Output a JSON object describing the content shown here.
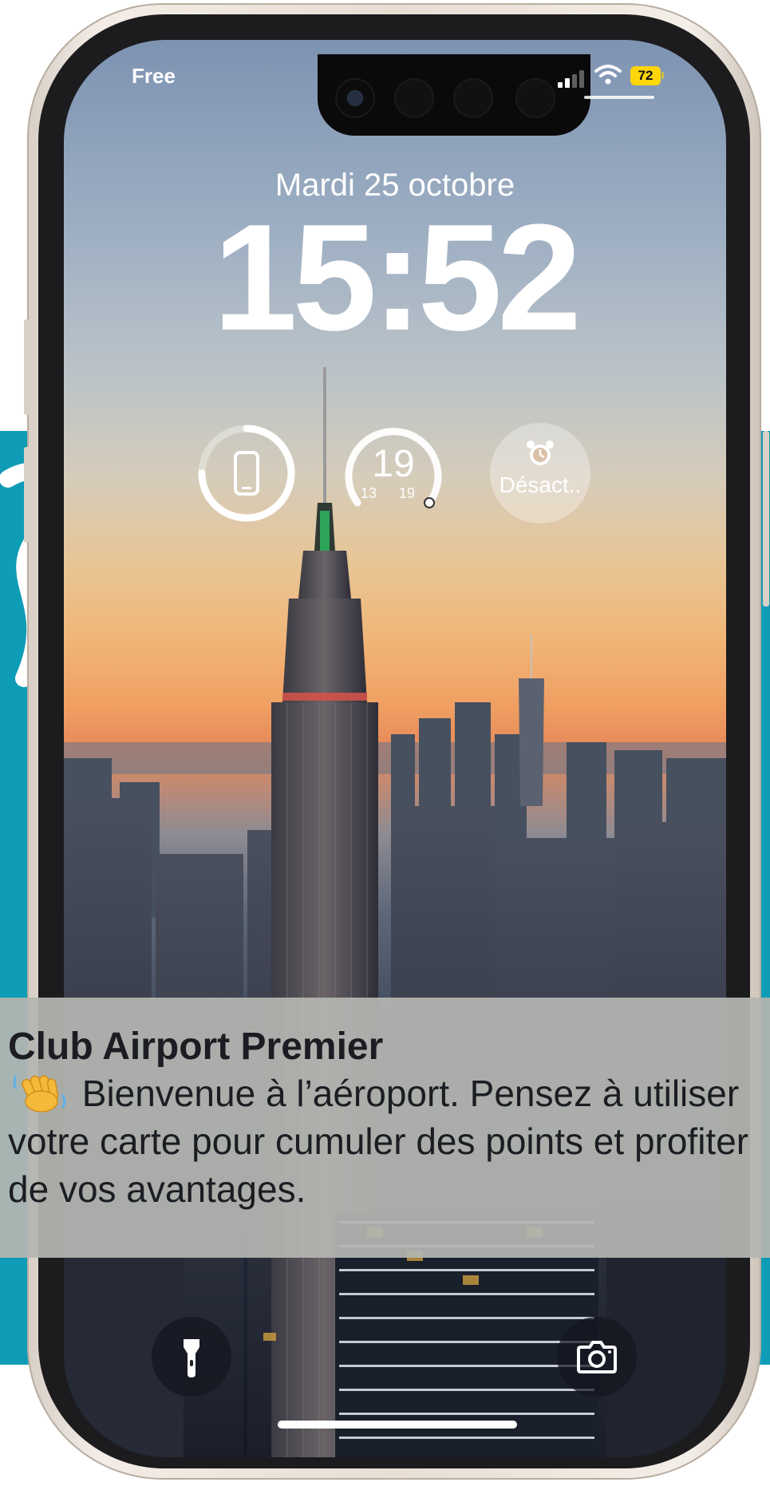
{
  "status_bar": {
    "carrier": "Free",
    "battery_level": "72",
    "battery_color": "#ffd60a",
    "signal_bars_active": 2,
    "signal_bars_total": 4
  },
  "lock_screen": {
    "date": "Mardi 25 octobre",
    "time": "15:52"
  },
  "widgets": {
    "battery_widget": {
      "icon": "phone-icon",
      "charge_fraction": 0.75
    },
    "temperature_widget": {
      "current": "19",
      "low": "13",
      "high": "19"
    },
    "alarm_widget": {
      "icon": "alarm-clock-icon",
      "label": "Désact.."
    }
  },
  "notification": {
    "app": "Club Airport Premier",
    "emoji": "waving-hand-icon",
    "message": "Bienvenue à l’aéroport. Pensez à utiliser votre carte pour cumuler des points et profiter de vos avantages."
  },
  "bottom_controls": {
    "left": "flashlight-icon",
    "right": "camera-icon"
  },
  "colors": {
    "backdrop": "#0f9cb6",
    "frame": "#e7ded4"
  }
}
